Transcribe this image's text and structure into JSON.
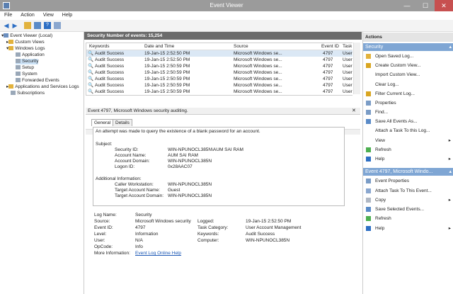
{
  "window": {
    "title": "Event Viewer",
    "minimize": "—",
    "maximize": "☐",
    "close": "✕"
  },
  "menu": [
    "File",
    "Action",
    "View",
    "Help"
  ],
  "tree": [
    {
      "label": "Event Viewer (Local)",
      "level": 0,
      "expander": "▾"
    },
    {
      "label": "Custom Views",
      "level": 1,
      "expander": "▸"
    },
    {
      "label": "Windows Logs",
      "level": 1,
      "expander": "▾"
    },
    {
      "label": "Application",
      "level": 2,
      "expander": ""
    },
    {
      "label": "Security",
      "level": 2,
      "expander": "",
      "selected": true
    },
    {
      "label": "Setup",
      "level": 2,
      "expander": ""
    },
    {
      "label": "System",
      "level": 2,
      "expander": ""
    },
    {
      "label": "Forwarded Events",
      "level": 2,
      "expander": ""
    },
    {
      "label": "Applications and Services Logs",
      "level": 1,
      "expander": "▸"
    },
    {
      "label": "Subscriptions",
      "level": 1,
      "expander": ""
    }
  ],
  "log": {
    "header": "Security    Number of events: 15,254",
    "columns": [
      "Keywords",
      "Date and Time",
      "Source",
      "Event ID",
      "Task"
    ],
    "rows": [
      [
        "Audit Success",
        "19-Jan-15 2:52:50 PM",
        "Microsoft Windows se...",
        "4797",
        "User"
      ],
      [
        "Audit Success",
        "19-Jan-15 2:52:50 PM",
        "Microsoft Windows se...",
        "4797",
        "User"
      ],
      [
        "Audit Success",
        "19-Jan-15 2:50:59 PM",
        "Microsoft Windows se...",
        "4797",
        "User"
      ],
      [
        "Audit Success",
        "19-Jan-15 2:50:59 PM",
        "Microsoft Windows se...",
        "4797",
        "User"
      ],
      [
        "Audit Success",
        "19-Jan-15 2:50:59 PM",
        "Microsoft Windows se...",
        "4797",
        "User"
      ],
      [
        "Audit Success",
        "19-Jan-15 2:50:59 PM",
        "Microsoft Windows se...",
        "4797",
        "User"
      ],
      [
        "Audit Success",
        "19-Jan-15 2:50:59 PM",
        "Microsoft Windows se...",
        "4797",
        "User"
      ]
    ]
  },
  "detail": {
    "title": "Event 4797, Microsoft Windows security auditing.",
    "close": "✕",
    "tabs": [
      "General",
      "Details"
    ],
    "message": [
      "An attempt was made to query the existence of a blank password for an account.",
      "Subject:",
      "Security ID:",
      "WIN-NPUNOCL385N\\AUM SAI RAM",
      "Account Name:",
      "AUM SAI RAM",
      "Account Domain:",
      "WIN-NPUNOCL385N",
      "Logon ID:",
      "0x28AAC07",
      "Additional Information:",
      "Caller Workstation:",
      "WIN-NPUNOCL385N",
      "Target Account Name:",
      "Guest",
      "Target Account Domain:",
      "WIN-NPUNOCL385N"
    ],
    "props": {
      "log_name_label": "Log Name:",
      "log_name": "Security",
      "source_label": "Source:",
      "source": "Microsoft Windows security",
      "logged_label": "Logged:",
      "logged": "19-Jan-15 2:52:50 PM",
      "event_id_label": "Event ID:",
      "event_id": "4797",
      "task_label": "Task Category:",
      "task": "User Account Management",
      "level_label": "Level:",
      "level": "Information",
      "keywords_label": "Keywords:",
      "keywords": "Audit Success",
      "user_label": "User:",
      "user": "N/A",
      "computer_label": "Computer:",
      "computer": "WIN-NPUNOCL385N",
      "opcode_label": "OpCode:",
      "opcode": "Info",
      "more_label": "More Information:",
      "more_link": "Event Log Online Help"
    }
  },
  "actions": {
    "title": "Actions",
    "section1": "Security",
    "items1": [
      {
        "label": "Open Saved Log...",
        "icon": "folder-icon",
        "arrow": ""
      },
      {
        "label": "Create Custom View...",
        "icon": "filter-icon",
        "arrow": ""
      },
      {
        "label": "Import Custom View...",
        "icon": "",
        "arrow": ""
      },
      {
        "label": "Clear Log...",
        "icon": "",
        "arrow": ""
      },
      {
        "label": "Filter Current Log...",
        "icon": "filter-icon",
        "arrow": ""
      },
      {
        "label": "Properties",
        "icon": "properties-icon",
        "arrow": ""
      },
      {
        "label": "Find...",
        "icon": "find-icon",
        "arrow": ""
      },
      {
        "label": "Save All Events As...",
        "icon": "save-icon",
        "arrow": ""
      },
      {
        "label": "Attach a Task To this Log...",
        "icon": "",
        "arrow": ""
      },
      {
        "label": "View",
        "icon": "",
        "arrow": "▸"
      },
      {
        "label": "Refresh",
        "icon": "refresh-icon",
        "arrow": ""
      },
      {
        "label": "Help",
        "icon": "help-icon",
        "arrow": "▸"
      }
    ],
    "section2": "Event 4797, Microsoft Windo...",
    "items2": [
      {
        "label": "Event Properties",
        "icon": "properties-icon",
        "arrow": ""
      },
      {
        "label": "Attach Task To This Event...",
        "icon": "task-icon",
        "arrow": ""
      },
      {
        "label": "Copy",
        "icon": "copy-icon",
        "arrow": "▸"
      },
      {
        "label": "Save Selected Events...",
        "icon": "save-icon",
        "arrow": ""
      },
      {
        "label": "Refresh",
        "icon": "refresh-icon",
        "arrow": ""
      },
      {
        "label": "Help",
        "icon": "help-icon",
        "arrow": "▸"
      }
    ]
  },
  "colors": {
    "section_bar": "#7fa6d4",
    "header_bar": "#6b6b6b",
    "title_bar": "#9b9b9b"
  }
}
